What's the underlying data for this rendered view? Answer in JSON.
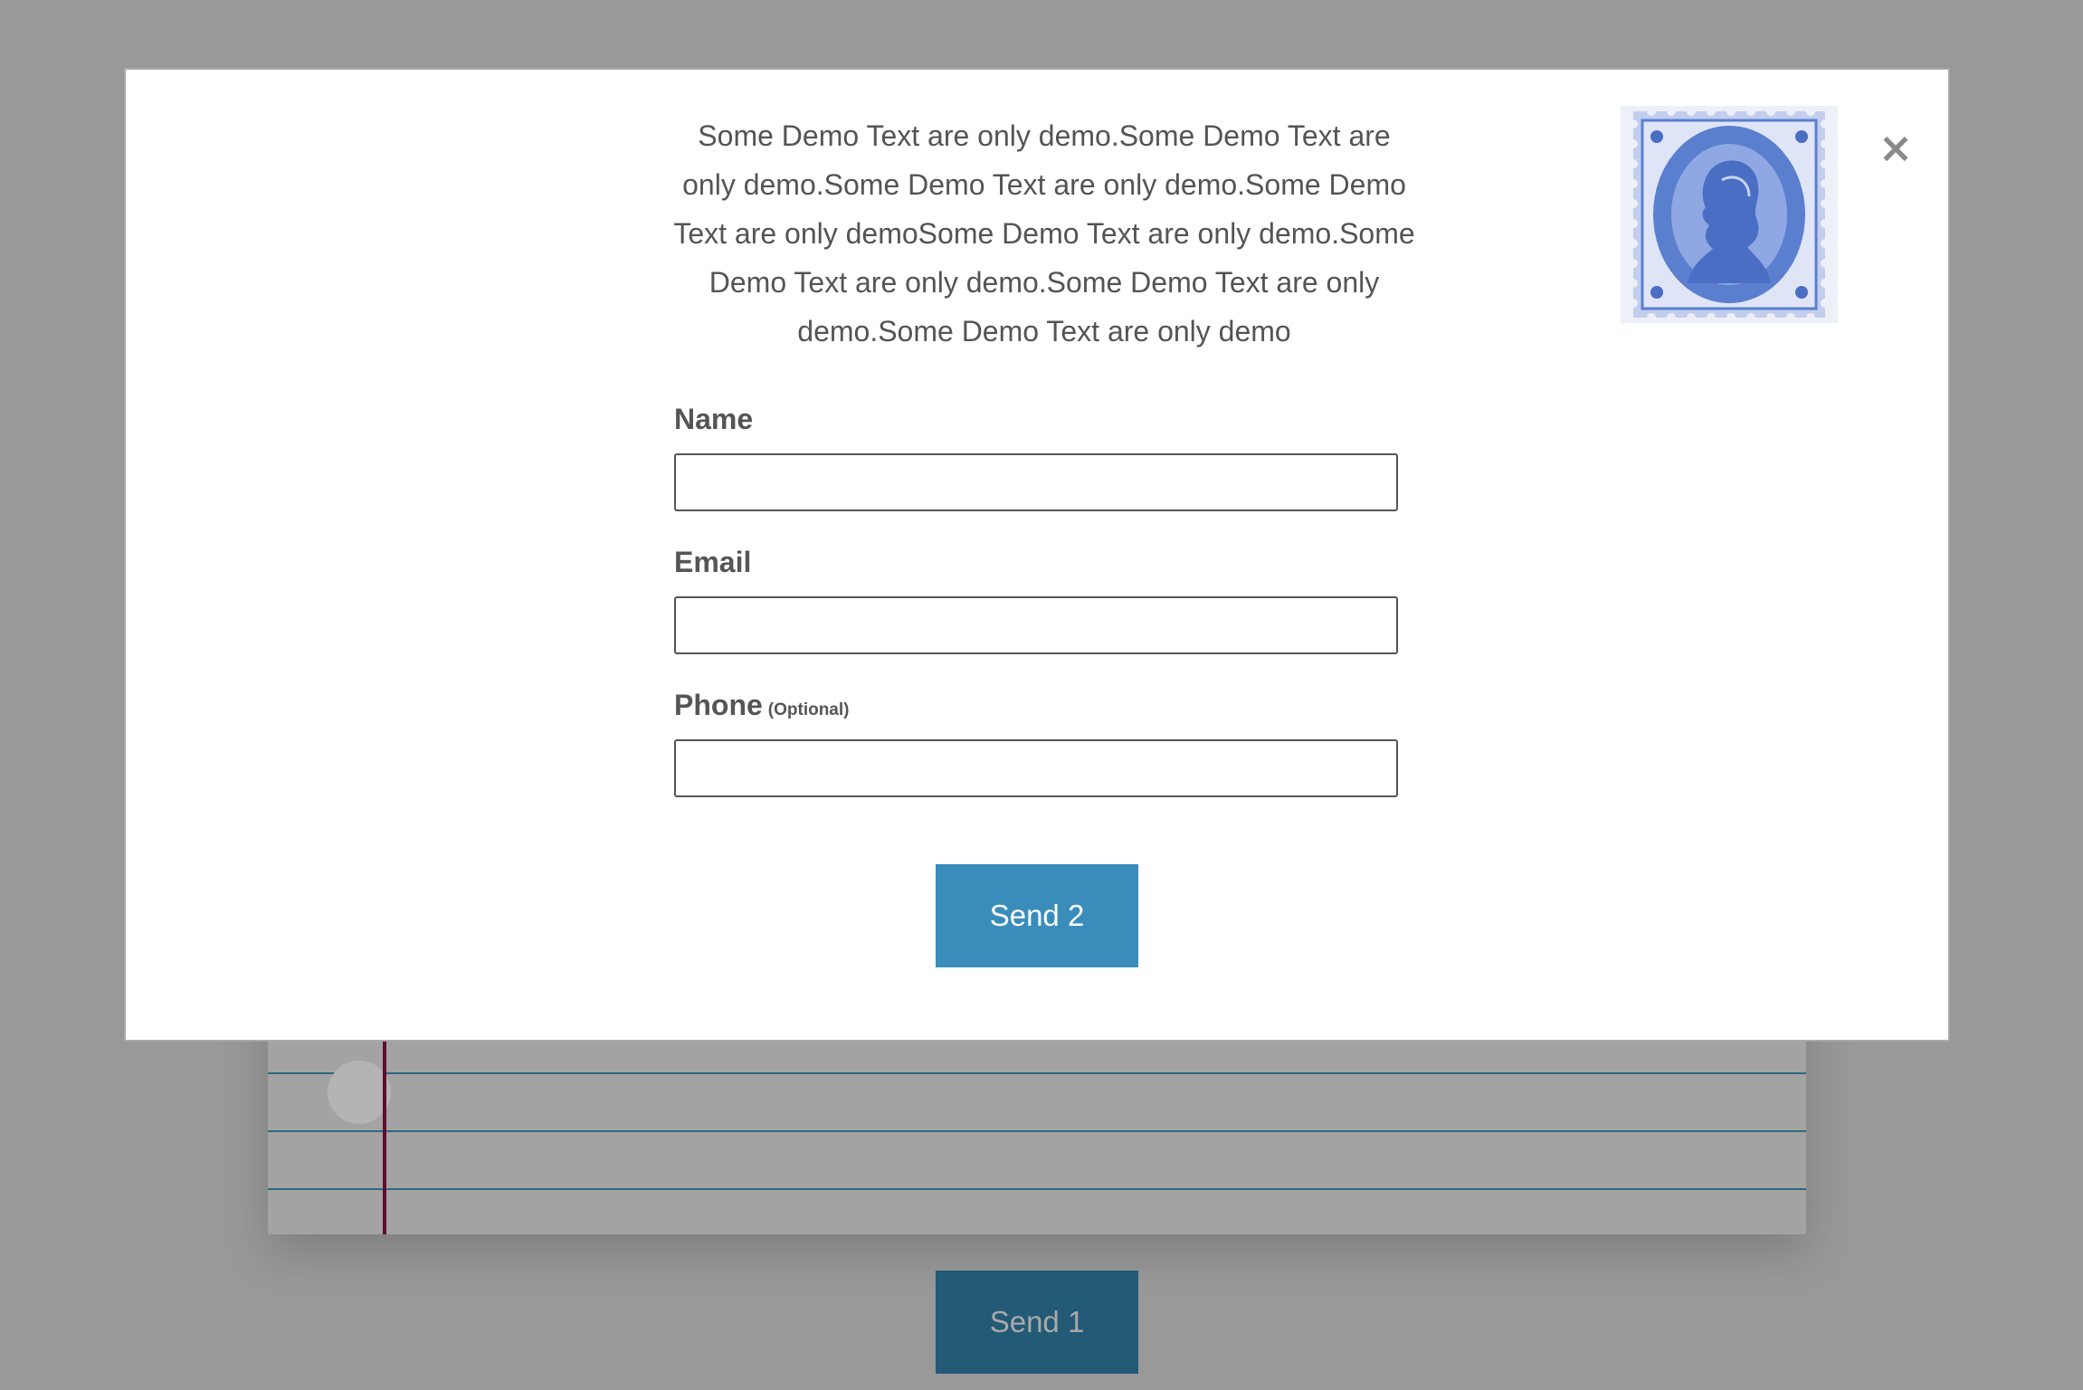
{
  "background": {
    "send_button_label": "Send 1"
  },
  "modal": {
    "close_icon": "×",
    "intro_text": "Some Demo Text are only demo.Some Demo Text are only demo.Some Demo Text are only demo.Some Demo Text are only demoSome Demo Text are only demo.Some Demo Text are only demo.Some Demo Text are only demo.Some Demo Text are only demo",
    "stamp_image": "stamp-duty-nz-one-penny",
    "form": {
      "name_label": "Name",
      "name_value": "",
      "email_label": "Email",
      "email_value": "",
      "phone_label": "Phone",
      "phone_optional": "(Optional)",
      "phone_value": ""
    },
    "send_button_label": "Send 2"
  },
  "colors": {
    "overlay": "#999999",
    "primary_button": "#3a8cbb",
    "background_button": "#235a76"
  }
}
